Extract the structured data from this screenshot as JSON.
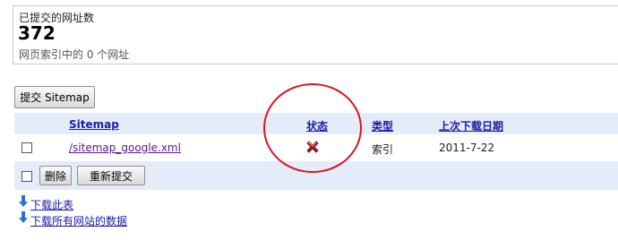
{
  "stats": {
    "label": "已提交的网址数",
    "count": "372",
    "subtext": "网页索引中的  0 个网址"
  },
  "submit_button": "提交 Sitemap",
  "table": {
    "headers": {
      "sitemap": "Sitemap",
      "status": "状态",
      "type": "类型",
      "last_download": "上次下载日期"
    },
    "rows": [
      {
        "sitemap": "/sitemap_google.xml",
        "status_icon": "error-x-icon",
        "type": "索引",
        "last_download": "2011-7-22"
      }
    ]
  },
  "actions": {
    "delete": "删除",
    "resubmit": "重新提交"
  },
  "downloads": {
    "table": "下载此表",
    "all_sites": "下载所有网站的数据"
  },
  "colors": {
    "header_bg": "#e5ecf9",
    "link": "#1a1aa6",
    "visited_link": "#551a8b",
    "annotation_circle": "#e0121d",
    "error_icon": "#b3141c"
  }
}
